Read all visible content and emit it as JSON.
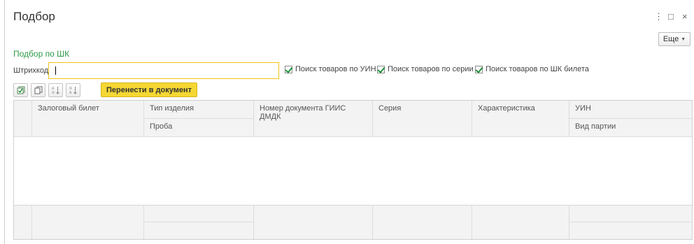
{
  "window": {
    "title": "Подбор",
    "more_label": "Еще"
  },
  "section": {
    "title": "Подбор по ШК",
    "barcode_label": "Штрихкод:",
    "barcode_value": ""
  },
  "checkboxes": [
    {
      "label": "Поиск товаров по УИН",
      "checked": true
    },
    {
      "label": "Поиск товаров по серии",
      "checked": true
    },
    {
      "label": "Поиск товаров по ШК билета",
      "checked": true
    }
  ],
  "toolbar": {
    "transfer_label": "Перенести в документ",
    "icons": [
      "check-all-icon",
      "copy-icon",
      "sort-ascending-icon",
      "sort-descending-icon"
    ]
  },
  "table": {
    "columns_row1": [
      "Залоговый билет",
      "Тип изделия",
      "Номер документа ГИИС ДМДК",
      "Серия",
      "Характеристика",
      "УИН"
    ],
    "columns_row2": [
      "Проба",
      "Вид партии"
    ]
  }
}
